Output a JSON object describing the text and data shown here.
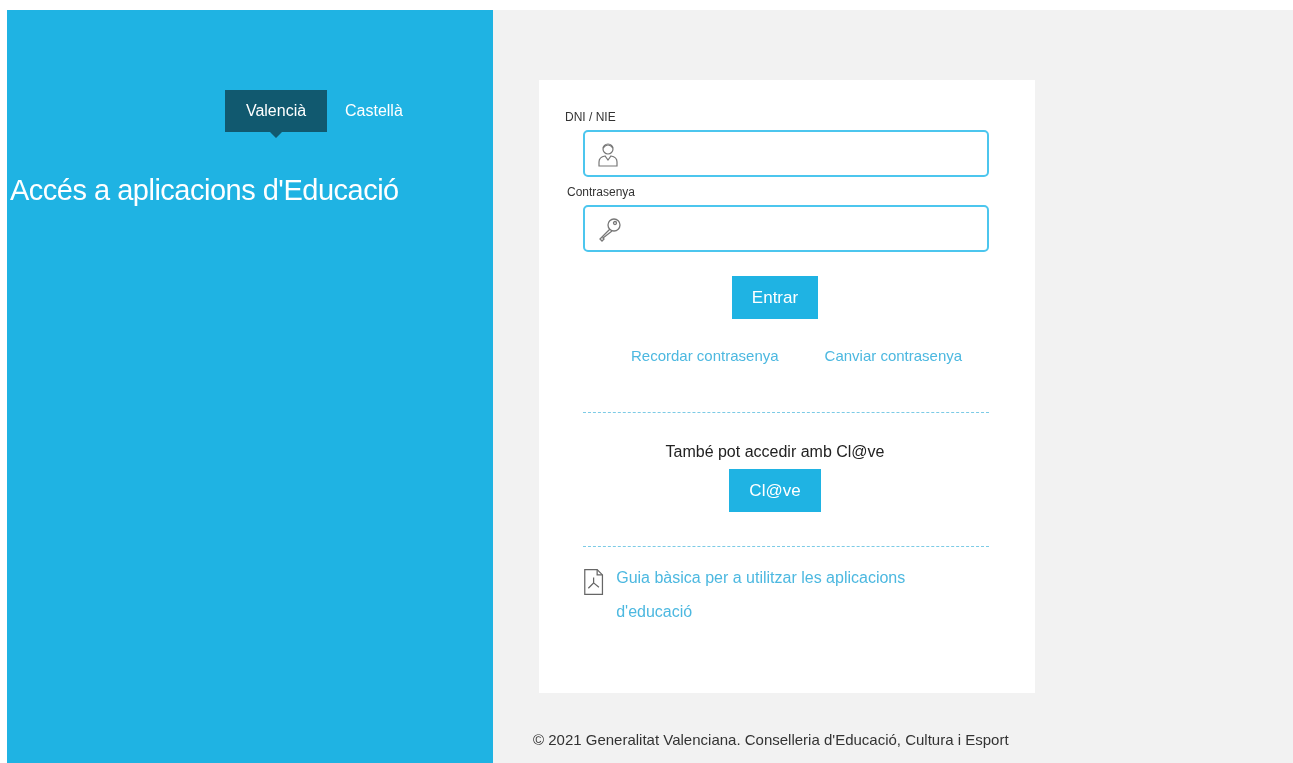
{
  "languages": [
    {
      "label": "Valencià",
      "selected": true
    },
    {
      "label": "Castellà",
      "selected": false
    }
  ],
  "title": "Accés a aplicacions d'Educació",
  "form": {
    "fields": [
      {
        "label": "DNI / NIE",
        "kind": "user"
      },
      {
        "label": "Contrasenya",
        "kind": "password"
      }
    ],
    "submit": "Entrar",
    "links": [
      "Recordar contrasenya",
      "Canviar contrasenya"
    ],
    "alt_text": "També pot accedir amb Cl@ve",
    "alt_button": "Cl@ve",
    "guide_link": "Guia bàsica per a utilitzar les aplicacions d'educació"
  },
  "footer": "© 2021 Generalitat Valenciana. Conselleria d'Educació, Cultura i Esport"
}
